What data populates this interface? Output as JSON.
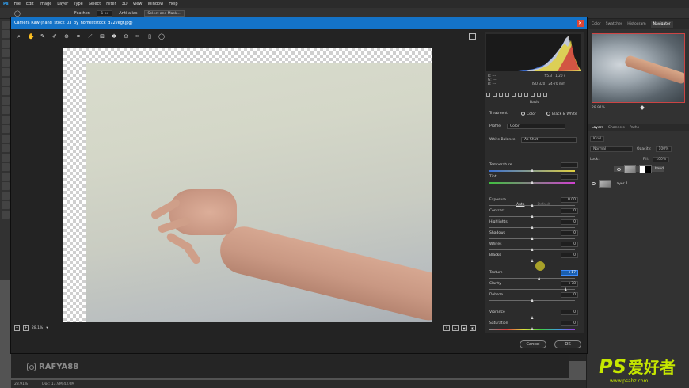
{
  "menubar": {
    "logo": "Ps",
    "items": [
      "File",
      "Edit",
      "Image",
      "Layer",
      "Type",
      "Select",
      "Filter",
      "3D",
      "View",
      "Window",
      "Help"
    ]
  },
  "options": {
    "feather_label": "Feather:",
    "feather_value": "1 px",
    "antialias": "Anti-alias",
    "select_mask": "Select and Mask..."
  },
  "dialog": {
    "title": "Camera Raw (hand_stock_03_by_nomeststock_d72vegf.jpg)",
    "zoom": "28.1%",
    "cancel": "Cancel",
    "ok": "OK"
  },
  "readout": {
    "r": "R:",
    "g": "G:",
    "b": "B:",
    "dash": "---",
    "fstop": "f/5.3",
    "shutter": "1/20 s",
    "iso": "ISO 320",
    "focal": "24-70 mm"
  },
  "basic": {
    "section": "Basic",
    "treatment_label": "Treatment:",
    "color_option": "Color",
    "bw_option": "Black & White",
    "profile_label": "Profile:",
    "profile_value": "Color",
    "wb_label": "White Balance:",
    "wb_value": "As Shot",
    "auto": "Auto",
    "default": "Default"
  },
  "sliders": [
    {
      "label": "Temperature",
      "value": "",
      "pos": 0.5,
      "kind": "temp"
    },
    {
      "label": "Tint",
      "value": "",
      "pos": 0.5,
      "kind": "tint"
    },
    {
      "label": "Exposure",
      "value": "0.00",
      "pos": 0.5,
      "kind": "plain"
    },
    {
      "label": "Contrast",
      "value": "0",
      "pos": 0.5,
      "kind": "plain"
    },
    {
      "label": "Highlights",
      "value": "0",
      "pos": 0.5,
      "kind": "plain"
    },
    {
      "label": "Shadows",
      "value": "0",
      "pos": 0.5,
      "kind": "plain"
    },
    {
      "label": "Whites",
      "value": "0",
      "pos": 0.5,
      "kind": "plain"
    },
    {
      "label": "Blacks",
      "value": "0",
      "pos": 0.5,
      "kind": "plain"
    },
    {
      "label": "Texture",
      "value": "+17",
      "pos": 0.58,
      "kind": "plain",
      "highlight": true
    },
    {
      "label": "Clarity",
      "value": "+78",
      "pos": 0.89,
      "kind": "plain"
    },
    {
      "label": "Dehaze",
      "value": "0",
      "pos": 0.5,
      "kind": "plain"
    },
    {
      "label": "Vibrance",
      "value": "0",
      "pos": 0.5,
      "kind": "plain"
    },
    {
      "label": "Saturation",
      "value": "0",
      "pos": 0.5,
      "kind": "sat"
    }
  ],
  "right_panels": {
    "tabs": [
      "Color",
      "Swatches",
      "Histogram",
      "Navigator"
    ],
    "nav_zoom": "28.91%",
    "layer_tabs": [
      "Layers",
      "Channels",
      "Paths"
    ],
    "kind": "Kind",
    "blend_mode": "Normal",
    "opacity_label": "Opacity:",
    "opacity": "100%",
    "lock_label": "Lock:",
    "fill_label": "Fill:",
    "fill": "100%",
    "layers": [
      {
        "name": "hand",
        "selected": true
      },
      {
        "name": "Layer 1",
        "selected": false
      }
    ]
  },
  "status": {
    "zoom": "28.91%",
    "doc": "Doc: 13.9M/43.0M"
  },
  "watermark": {
    "handle": "RAFYA88",
    "brand_ps": "PS",
    "brand_cn": "爱好者",
    "url": "www.psahz.com"
  },
  "colors": {
    "accent": "#1473c8",
    "brand": "#c5e600"
  }
}
